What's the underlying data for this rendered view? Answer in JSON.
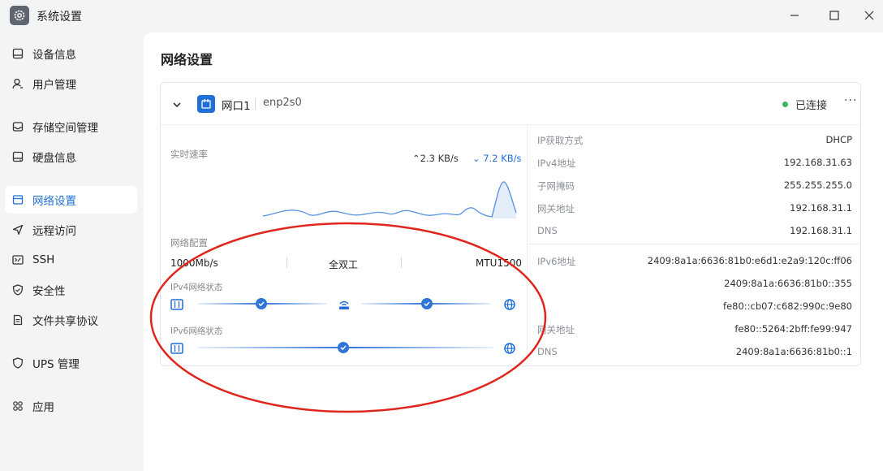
{
  "window": {
    "title": "系统设置"
  },
  "sidebar": {
    "items": [
      {
        "label": "设备信息"
      },
      {
        "label": "用户管理"
      },
      {
        "label": "存储空间管理"
      },
      {
        "label": "硬盘信息"
      },
      {
        "label": "网络设置"
      },
      {
        "label": "远程访问"
      },
      {
        "label": "SSH"
      },
      {
        "label": "安全性"
      },
      {
        "label": "文件共享协议"
      },
      {
        "label": "UPS 管理"
      },
      {
        "label": "应用"
      }
    ],
    "active": "网络设置"
  },
  "page": {
    "title": "网络设置"
  },
  "port": {
    "name": "网口1",
    "interface": "enp2s0",
    "status": "已连接",
    "more": "···",
    "speed_label": "实时速率",
    "upload": "2.3 KB/s",
    "download": "7.2 KB/s",
    "config_label": "网络配置",
    "link_speed": "1000Mb/s",
    "duplex": "全双工",
    "mtu": "MTU1500",
    "ipv4_status_label": "IPv4网络状态",
    "ipv6_status_label": "IPv6网络状态"
  },
  "ipv4": [
    {
      "key": "IP获取方式",
      "value": "DHCP"
    },
    {
      "key": "IPv4地址",
      "value": "192.168.31.63"
    },
    {
      "key": "子网掩码",
      "value": "255.255.255.0"
    },
    {
      "key": "网关地址",
      "value": "192.168.31.1"
    },
    {
      "key": "DNS",
      "value": "192.168.31.1"
    }
  ],
  "ipv6": {
    "address_label": "IPv6地址",
    "addresses": [
      "2409:8a1a:6636:81b0:e6d1:e2a9:120c:ff06",
      "2409:8a1a:6636:81b0::355",
      "fe80::cb07:c682:990c:9e80"
    ],
    "gateway_label": "网关地址",
    "gateway": "fe80::5264:2bff:fe99:947",
    "dns_label": "DNS",
    "dns": "2409:8a1a:6636:81b0::1"
  },
  "colors": {
    "accent": "#1f6fd6",
    "connected": "#3bb561",
    "annotation": "#e0261c"
  }
}
